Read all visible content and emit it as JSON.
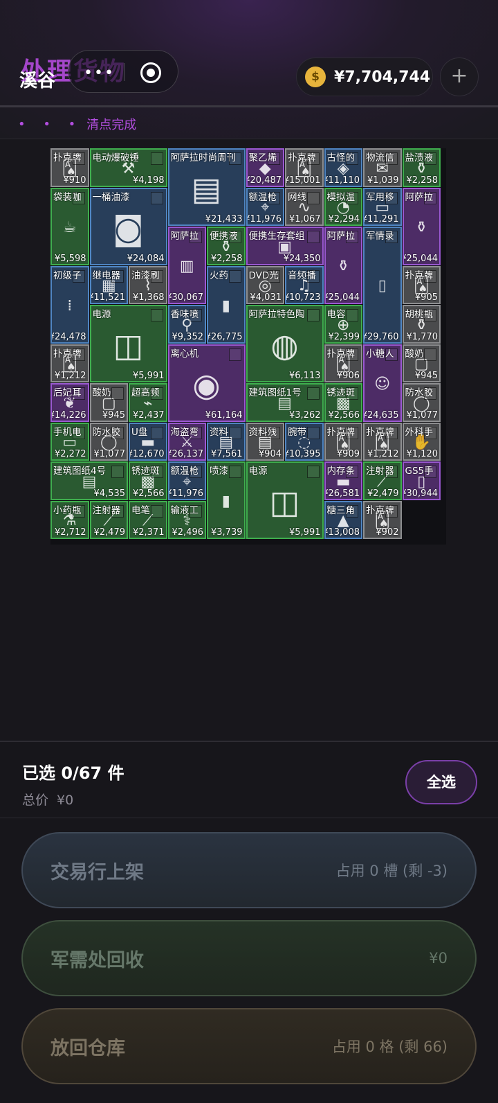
{
  "header": {
    "title": "处理货物",
    "location": "溪谷",
    "capsule_dots": "•••",
    "coin_symbol": "$",
    "balance": "¥7,704,744",
    "add_label": "+"
  },
  "status": {
    "dots": "• • •",
    "text": "清点完成"
  },
  "items": [
    {
      "name": "扑克牌",
      "price": "¥910",
      "color": "gray",
      "icon": "card-icon"
    },
    {
      "name": "电动爆破锤",
      "price": "¥4,198",
      "color": "green",
      "icon": "drill-icon"
    },
    {
      "name": "阿萨拉时尚周刊",
      "price": "¥21,433",
      "color": "blue",
      "icon": "magazine-icon"
    },
    {
      "name": "聚乙烯",
      "price": "¥20,487",
      "color": "purple",
      "icon": "material-icon"
    },
    {
      "name": "扑克牌",
      "price": "¥15,001",
      "color": "gray",
      "icon": "card-icon"
    },
    {
      "name": "古怪的",
      "price": "¥11,110",
      "color": "blue",
      "icon": "object-icon"
    },
    {
      "name": "物流信",
      "price": "¥1,039",
      "color": "gray",
      "icon": "letter-icon"
    },
    {
      "name": "盐渍液",
      "price": "¥2,258",
      "color": "green",
      "icon": "bottle-icon"
    },
    {
      "name": "袋装咖",
      "price": "¥5,598",
      "color": "green",
      "icon": "coffee-icon"
    },
    {
      "name": "一桶油漆",
      "price": "¥24,084",
      "color": "blue",
      "icon": "paint-can-icon"
    },
    {
      "name": "额温枪",
      "price": "¥11,976",
      "color": "blue",
      "icon": "thermometer-icon"
    },
    {
      "name": "网线",
      "price": "¥1,067",
      "color": "gray",
      "icon": "cable-icon"
    },
    {
      "name": "模拟温",
      "price": "¥2,294",
      "color": "green",
      "icon": "gauge-icon"
    },
    {
      "name": "军用移",
      "price": "¥11,291",
      "color": "blue",
      "icon": "drive-icon"
    },
    {
      "name": "阿萨拉",
      "price": "¥25,044",
      "color": "purple",
      "icon": "teapot-icon"
    },
    {
      "name": "阿萨拉",
      "price": "¥30,067",
      "color": "purple",
      "icon": "book-icon"
    },
    {
      "name": "便携液",
      "price": "¥2,258",
      "color": "green",
      "icon": "bottle-icon"
    },
    {
      "name": "便携生存套组",
      "price": "¥24,350",
      "color": "purple",
      "icon": "kit-icon"
    },
    {
      "name": "阿萨拉",
      "price": "¥25,044",
      "color": "purple",
      "icon": "teapot-icon"
    },
    {
      "name": "军情录",
      "price": "¥29,760",
      "color": "blue",
      "icon": "recorder-icon"
    },
    {
      "name": "初级子",
      "price": "¥24,478",
      "color": "blue",
      "icon": "ammo-icon"
    },
    {
      "name": "继电器",
      "price": "¥11,521",
      "color": "blue",
      "icon": "relay-icon"
    },
    {
      "name": "油漆刷",
      "price": "¥1,368",
      "color": "gray",
      "icon": "brush-icon"
    },
    {
      "name": "火药",
      "price": "¥26,775",
      "color": "blue",
      "icon": "powder-icon"
    },
    {
      "name": "DVD光",
      "price": "¥4,031",
      "color": "gray",
      "icon": "disc-icon"
    },
    {
      "name": "音频播",
      "price": "¥10,723",
      "color": "blue",
      "icon": "audio-icon"
    },
    {
      "name": "扑克牌",
      "price": "¥905",
      "color": "gray",
      "icon": "card-icon"
    },
    {
      "name": "电源",
      "price": "¥5,991",
      "color": "green",
      "icon": "psu-icon"
    },
    {
      "name": "香味喷",
      "price": "¥9,352",
      "color": "blue",
      "icon": "spray-icon"
    },
    {
      "name": "阿萨拉特色陶",
      "price": "¥6,113",
      "color": "green",
      "icon": "pot-icon"
    },
    {
      "name": "电容",
      "price": "¥2,399",
      "color": "green",
      "icon": "capacitor-icon"
    },
    {
      "name": "胡桃瓶",
      "price": "¥1,770",
      "color": "gray",
      "icon": "bottle-icon"
    },
    {
      "name": "扑克牌",
      "price": "¥1,212",
      "color": "gray",
      "icon": "card-icon"
    },
    {
      "name": "离心机",
      "price": "¥61,164",
      "color": "purple",
      "icon": "centrifuge-icon"
    },
    {
      "name": "扑克牌",
      "price": "¥906",
      "color": "gray",
      "icon": "card-icon"
    },
    {
      "name": "小糖人",
      "price": "¥24,635",
      "color": "purple",
      "icon": "gingerbread-icon"
    },
    {
      "name": "酸奶",
      "price": "¥945",
      "color": "gray",
      "icon": "yogurt-icon"
    },
    {
      "name": "后妃耳",
      "price": "¥14,226",
      "color": "purple",
      "icon": "earring-icon"
    },
    {
      "name": "酸奶",
      "price": "¥945",
      "color": "gray",
      "icon": "yogurt-icon"
    },
    {
      "name": "超高频",
      "price": "¥2,437",
      "color": "green",
      "icon": "radio-icon"
    },
    {
      "name": "建筑图纸1号",
      "price": "¥3,262",
      "color": "green",
      "icon": "blueprint-icon"
    },
    {
      "name": "锈迹斑",
      "price": "¥2,566",
      "color": "green",
      "icon": "rust-icon"
    },
    {
      "name": "防水胶",
      "price": "¥1,077",
      "color": "gray",
      "icon": "tape-icon"
    },
    {
      "name": "手机电",
      "price": "¥2,272",
      "color": "green",
      "icon": "battery-icon"
    },
    {
      "name": "防水胶",
      "price": "¥1,077",
      "color": "gray",
      "icon": "tape-icon"
    },
    {
      "name": "U盘",
      "price": "¥12,670",
      "color": "blue",
      "icon": "usb-icon"
    },
    {
      "name": "海盗弯",
      "price": "¥26,137",
      "color": "purple",
      "icon": "sword-icon"
    },
    {
      "name": "资料",
      "price": "¥7,561",
      "color": "blue",
      "icon": "document-icon"
    },
    {
      "name": "资料残",
      "price": "¥904",
      "color": "gray",
      "icon": "document-icon"
    },
    {
      "name": "腕带",
      "price": "¥10,395",
      "color": "blue",
      "icon": "wristband-icon"
    },
    {
      "name": "扑克牌",
      "price": "¥909",
      "color": "gray",
      "icon": "card-icon"
    },
    {
      "name": "扑克牌",
      "price": "¥1,212",
      "color": "gray",
      "icon": "card-icon"
    },
    {
      "name": "外科手",
      "price": "¥1,120",
      "color": "gray",
      "icon": "glove-icon"
    },
    {
      "name": "建筑图纸4号",
      "price": "¥4,535",
      "color": "green",
      "icon": "blueprint-icon"
    },
    {
      "name": "锈迹斑",
      "price": "¥2,566",
      "color": "green",
      "icon": "rust-icon"
    },
    {
      "name": "额温枪",
      "price": "¥11,976",
      "color": "blue",
      "icon": "thermometer-icon"
    },
    {
      "name": "喷漆",
      "price": "¥3,739",
      "color": "green",
      "icon": "spray-can-icon"
    },
    {
      "name": "电源",
      "price": "¥5,991",
      "color": "green",
      "icon": "psu-icon"
    },
    {
      "name": "内存条",
      "price": "¥26,581",
      "color": "purple",
      "icon": "ram-icon"
    },
    {
      "name": "注射器",
      "price": "¥2,479",
      "color": "green",
      "icon": "syringe-icon"
    },
    {
      "name": "GS5手",
      "price": "¥30,944",
      "color": "purple",
      "icon": "phone-icon"
    },
    {
      "name": "小药瓶",
      "price": "¥2,712",
      "color": "green",
      "icon": "pill-bottle-icon"
    },
    {
      "name": "注射器",
      "price": "¥2,479",
      "color": "green",
      "icon": "syringe-icon"
    },
    {
      "name": "电笔",
      "price": "¥2,371",
      "color": "green",
      "icon": "tester-icon"
    },
    {
      "name": "输液工",
      "price": "¥2,496",
      "color": "green",
      "icon": "iv-icon"
    },
    {
      "name": "糖三角",
      "price": "¥13,008",
      "color": "blue",
      "icon": "candy-icon"
    },
    {
      "name": "扑克牌",
      "price": "¥902",
      "color": "gray",
      "icon": "card-icon"
    }
  ],
  "footer": {
    "selected": "已选 0/67 件",
    "total_label": "总价",
    "total_value": "¥0",
    "select_all": "全选"
  },
  "actions": {
    "market": {
      "label": "交易行上架",
      "info": "占用 0 槽 (剩 -3)"
    },
    "recycle": {
      "label": "军需处回收",
      "info": "¥0"
    },
    "warehouse": {
      "label": "放回仓库",
      "info": "占用 0 格 (剩 66)"
    }
  }
}
